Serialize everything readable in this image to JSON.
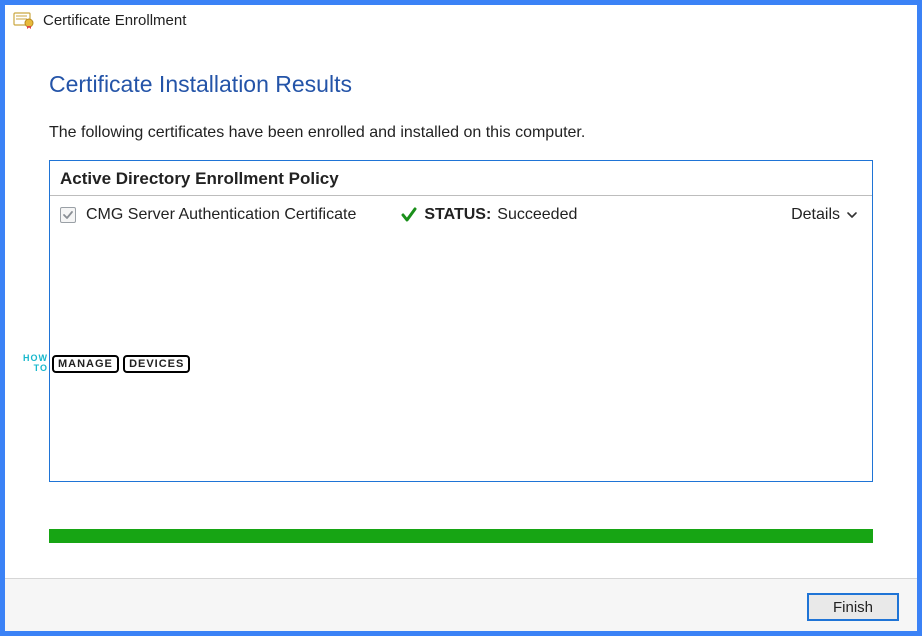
{
  "window": {
    "title": "Certificate Enrollment"
  },
  "page": {
    "heading": "Certificate Installation Results",
    "subtext": "The following certificates have been enrolled and installed on this computer."
  },
  "policy": {
    "header": "Active Directory Enrollment Policy",
    "items": [
      {
        "checked": true,
        "name": "CMG Server Authentication Certificate",
        "status_label": "STATUS:",
        "status_value": "Succeeded",
        "details_label": "Details"
      }
    ]
  },
  "footer": {
    "finish": "Finish"
  },
  "watermark": {
    "how": "HOW",
    "to": "TO",
    "manage": "MANAGE",
    "devices": "DEVICES"
  }
}
